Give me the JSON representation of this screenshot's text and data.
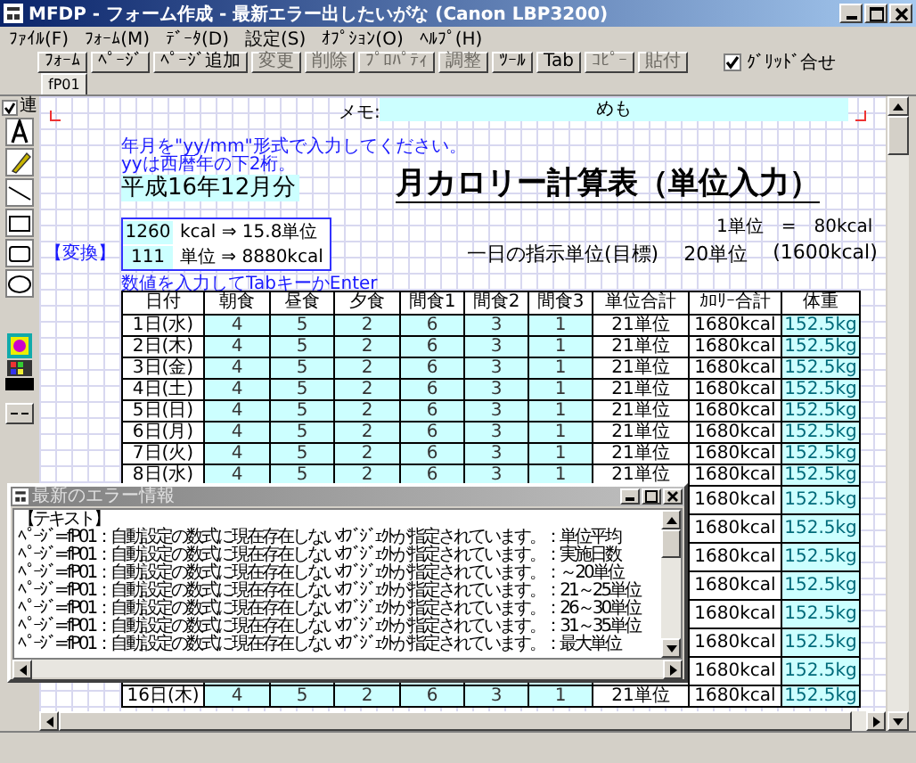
{
  "window": {
    "title": "MFDP - フォーム作成 - 最新エラー出したいがな (Canon LBP3200)"
  },
  "menu": [
    "ﾌｧｲﾙ(F)",
    "ﾌｫｰﾑ(M)",
    "ﾃﾞｰﾀ(D)",
    "設定(S)",
    "ｵﾌﾟｼｮﾝ(O)",
    "ﾍﾙﾌﾟ(H)"
  ],
  "toolbar": [
    {
      "label": "ﾌｫｰﾑ",
      "disabled": false
    },
    {
      "label": "ﾍﾟｰｼﾞ",
      "disabled": false
    },
    {
      "label": "ﾍﾟｰｼﾞ追加",
      "disabled": false
    },
    {
      "label": "変更",
      "disabled": true
    },
    {
      "label": "削除",
      "disabled": true
    },
    {
      "label": "ﾌﾟﾛﾊﾟﾃｨ",
      "disabled": true
    },
    {
      "label": "調整",
      "disabled": true
    },
    {
      "label": "ﾂｰﾙ",
      "disabled": false
    },
    {
      "label": "Tab",
      "disabled": false
    },
    {
      "label": "ｺﾋﾟｰ",
      "disabled": true
    },
    {
      "label": "貼付",
      "disabled": true
    }
  ],
  "grid_snap": {
    "label": "ｸﾞﾘｯﾄﾞ合せ",
    "checked": true
  },
  "tabs": [
    {
      "label": "fP01",
      "selected": true
    }
  ],
  "palette": {
    "link": {
      "label": "連",
      "checked": true
    }
  },
  "form": {
    "memo_label": "メモ:",
    "memo": "めも",
    "instruction": "年月を\"yy/mm\"形式で入力してください。yyは西暦年の下2桁。",
    "month": "平成16年12月分",
    "title": "月カロリー計算表（単位入力）",
    "unit_rate": "1単位　=　80kcal",
    "convert_label": "【変換】",
    "convert": [
      {
        "value": "1260",
        "text": "kcal ⇒ 15.8単位"
      },
      {
        "value": "111",
        "text": "単位 ⇒ 8880kcal"
      }
    ],
    "daily": [
      "一日の指示単位(目標)",
      "20単位",
      "(1600kcal)"
    ],
    "hint": "数値を入力してTabキーかEnter"
  },
  "table": {
    "columns": [
      {
        "label": "日付",
        "input": false
      },
      {
        "label": "朝食",
        "input": true
      },
      {
        "label": "昼食",
        "input": true
      },
      {
        "label": "夕食",
        "input": true
      },
      {
        "label": "間食1",
        "input": true
      },
      {
        "label": "間食2",
        "input": true
      },
      {
        "label": "間食3",
        "input": true
      },
      {
        "label": "単位合計",
        "input": false
      },
      {
        "label": "ｶﾛﾘｰ合計",
        "input": false
      },
      {
        "label": "体重",
        "input": true
      }
    ],
    "rows": [
      {
        "kind": "full",
        "cells": [
          "1日(水)",
          "4",
          "5",
          "2",
          "6",
          "3",
          "1",
          "21単位",
          "1680kcal",
          "152.5kg"
        ]
      },
      {
        "kind": "full",
        "cells": [
          "2日(木)",
          "4",
          "5",
          "2",
          "6",
          "3",
          "1",
          "21単位",
          "1680kcal",
          "152.5kg"
        ]
      },
      {
        "kind": "full",
        "cells": [
          "3日(金)",
          "4",
          "5",
          "2",
          "6",
          "3",
          "1",
          "21単位",
          "1680kcal",
          "152.5kg"
        ]
      },
      {
        "kind": "full",
        "cells": [
          "4日(土)",
          "4",
          "5",
          "2",
          "6",
          "3",
          "1",
          "21単位",
          "1680kcal",
          "152.5kg"
        ]
      },
      {
        "kind": "full",
        "cells": [
          "5日(日)",
          "4",
          "5",
          "2",
          "6",
          "3",
          "1",
          "21単位",
          "1680kcal",
          "152.5kg"
        ]
      },
      {
        "kind": "full",
        "cells": [
          "6日(月)",
          "4",
          "5",
          "2",
          "6",
          "3",
          "1",
          "21単位",
          "1680kcal",
          "152.5kg"
        ]
      },
      {
        "kind": "full",
        "cells": [
          "7日(火)",
          "4",
          "5",
          "2",
          "6",
          "3",
          "1",
          "21単位",
          "1680kcal",
          "152.5kg"
        ]
      },
      {
        "kind": "full",
        "cells": [
          "8日(水)",
          "4",
          "5",
          "2",
          "6",
          "3",
          "1",
          "21単位",
          "1680kcal",
          "152.5kg"
        ]
      },
      {
        "kind": "covered",
        "cells": [
          "1680kcal",
          "152.5kg"
        ]
      },
      {
        "kind": "covered",
        "cells": [
          "1680kcal",
          "152.5kg"
        ]
      },
      {
        "kind": "covered",
        "cells": [
          "1680kcal",
          "152.5kg"
        ]
      },
      {
        "kind": "covered",
        "cells": [
          "1680kcal",
          "152.5kg"
        ]
      },
      {
        "kind": "covered",
        "cells": [
          "1680kcal",
          "152.5kg"
        ]
      },
      {
        "kind": "covered",
        "cells": [
          "1680kcal",
          "152.5kg"
        ]
      },
      {
        "kind": "covered",
        "cells": [
          "1680kcal",
          "152.5kg"
        ]
      },
      {
        "kind": "full",
        "cells": [
          "16日(木)",
          "4",
          "5",
          "2",
          "6",
          "3",
          "1",
          "21単位",
          "1680kcal",
          "152.5kg"
        ]
      }
    ]
  },
  "error_window": {
    "title": "最新のエラー情報",
    "heading": "【テキスト】",
    "lines": [
      "ﾍﾟｰｼﾞ=fP01：自動設定の数式に現在存在しないｵﾌﾞｼﾞｪｸﾄが指定されています。：単位平均",
      "ﾍﾟｰｼﾞ=fP01：自動設定の数式に現在存在しないｵﾌﾞｼﾞｪｸﾄが指定されています。：実施日数",
      "ﾍﾟｰｼﾞ=fP01：自動設定の数式に現在存在しないｵﾌﾞｼﾞｪｸﾄが指定されています。：～20単位",
      "ﾍﾟｰｼﾞ=fP01：自動設定の数式に現在存在しないｵﾌﾞｼﾞｪｸﾄが指定されています。：21～25単位",
      "ﾍﾟｰｼﾞ=fP01：自動設定の数式に現在存在しないｵﾌﾞｼﾞｪｸﾄが指定されています。：26～30単位",
      "ﾍﾟｰｼﾞ=fP01：自動設定の数式に現在存在しないｵﾌﾞｼﾞｪｸﾄが指定されています。：31～35単位",
      "ﾍﾟｰｼﾞ=fP01：自動設定の数式に現在存在しないｵﾌﾞｼﾞｪｸﾄが指定されています。：最大単位"
    ]
  }
}
